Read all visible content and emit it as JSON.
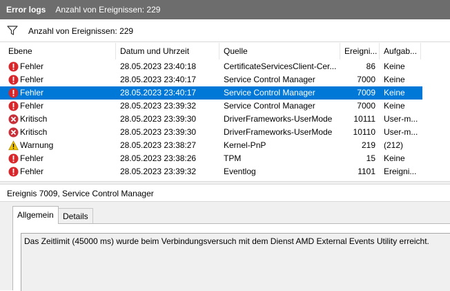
{
  "titlebar": {
    "app": "Error logs",
    "count": "Anzahl von Ereignissen: 229"
  },
  "filter": {
    "count_text": "Anzahl von Ereignissen: 229",
    "icon": "filter-icon"
  },
  "columns": [
    "Ebene",
    "Datum und Uhrzeit",
    "Quelle",
    "Ereigni...",
    "Aufgab..."
  ],
  "rows": [
    {
      "level": "Fehler",
      "type": "error",
      "date": "28.05.2023 23:40:18",
      "source": "CertificateServicesClient-Cer...",
      "id": "86",
      "task": "Keine"
    },
    {
      "level": "Fehler",
      "type": "error",
      "date": "28.05.2023 23:40:17",
      "source": "Service Control Manager",
      "id": "7000",
      "task": "Keine"
    },
    {
      "level": "Fehler",
      "type": "error",
      "date": "28.05.2023 23:40:17",
      "source": "Service Control Manager",
      "id": "7009",
      "task": "Keine",
      "selected": true
    },
    {
      "level": "Fehler",
      "type": "error",
      "date": "28.05.2023 23:39:32",
      "source": "Service Control Manager",
      "id": "7000",
      "task": "Keine"
    },
    {
      "level": "Kritisch",
      "type": "critical",
      "date": "28.05.2023 23:39:30",
      "source": "DriverFrameworks-UserMode",
      "id": "10111",
      "task": "User-m..."
    },
    {
      "level": "Kritisch",
      "type": "critical",
      "date": "28.05.2023 23:39:30",
      "source": "DriverFrameworks-UserMode",
      "id": "10110",
      "task": "User-m..."
    },
    {
      "level": "Warnung",
      "type": "warning",
      "date": "28.05.2023 23:38:27",
      "source": "Kernel-PnP",
      "id": "219",
      "task": "(212)"
    },
    {
      "level": "Fehler",
      "type": "error",
      "date": "28.05.2023 23:38:26",
      "source": "TPM",
      "id": "15",
      "task": "Keine"
    },
    {
      "level": "Fehler",
      "type": "error",
      "date": "28.05.2023 23:39:32",
      "source": "Eventlog",
      "id": "1101",
      "task": "Ereigni..."
    }
  ],
  "detail": {
    "title": "Ereignis 7009, Service Control Manager",
    "tabs": [
      "Allgemein",
      "Details"
    ],
    "active_tab": "Allgemein",
    "message": "Das Zeitlimit (45000 ms) wurde beim Verbindungsversuch mit dem Dienst AMD External Events Utility erreicht."
  },
  "colors": {
    "selection": "#0078d7",
    "titlebar": "#6d6d6d",
    "error": "#d9262b",
    "warning": "#f2c500",
    "critical": "#c8303a"
  }
}
